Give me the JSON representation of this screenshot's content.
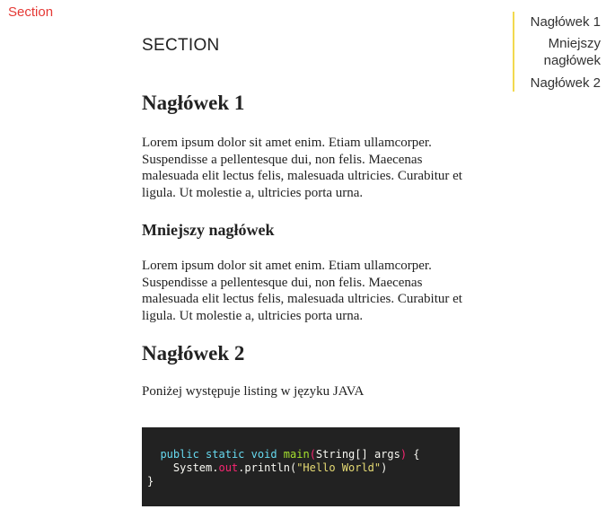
{
  "top_link": "Section",
  "toc": {
    "items": [
      "Nagłówek 1",
      "Mniejszy nagłówek",
      "Nagłówek 2"
    ]
  },
  "main": {
    "section_title": "SECTION",
    "heading1": "Nagłówek 1",
    "paragraph1": "Lorem ipsum dolor sit amet enim. Etiam ullamcorper. Suspendisse a pellentesque dui, non felis. Maecenas malesuada elit lectus felis, malesuada ultricies. Curabitur et ligula. Ut molestie a, ultricies porta urna.",
    "subheading": "Mniejszy nagłówek",
    "paragraph2": "Lorem ipsum dolor sit amet enim. Etiam ullamcorper. Suspendisse a pellentesque dui, non felis. Maecenas malesuada elit lectus felis, malesuada ultricies. Curabitur et ligula. Ut molestie a, ultricies porta urna.",
    "heading2": "Nagłówek 2",
    "paragraph3": "Poniżej występuje listing w języku JAVA"
  },
  "code": {
    "line1": {
      "kw1": "public",
      "kw2": "static",
      "kw3": "void",
      "fn": "main",
      "open": "(",
      "args": "String[] args",
      "close": ")",
      "brace": " {"
    },
    "line2": {
      "obj": "System.",
      "prop": "out",
      "call": ".println(",
      "str": "\"Hello World\"",
      "end": ")"
    },
    "line3": "}"
  },
  "colors": {
    "accent": "#e53935",
    "toc_border": "#f2d94e",
    "code_bg": "#222222"
  }
}
